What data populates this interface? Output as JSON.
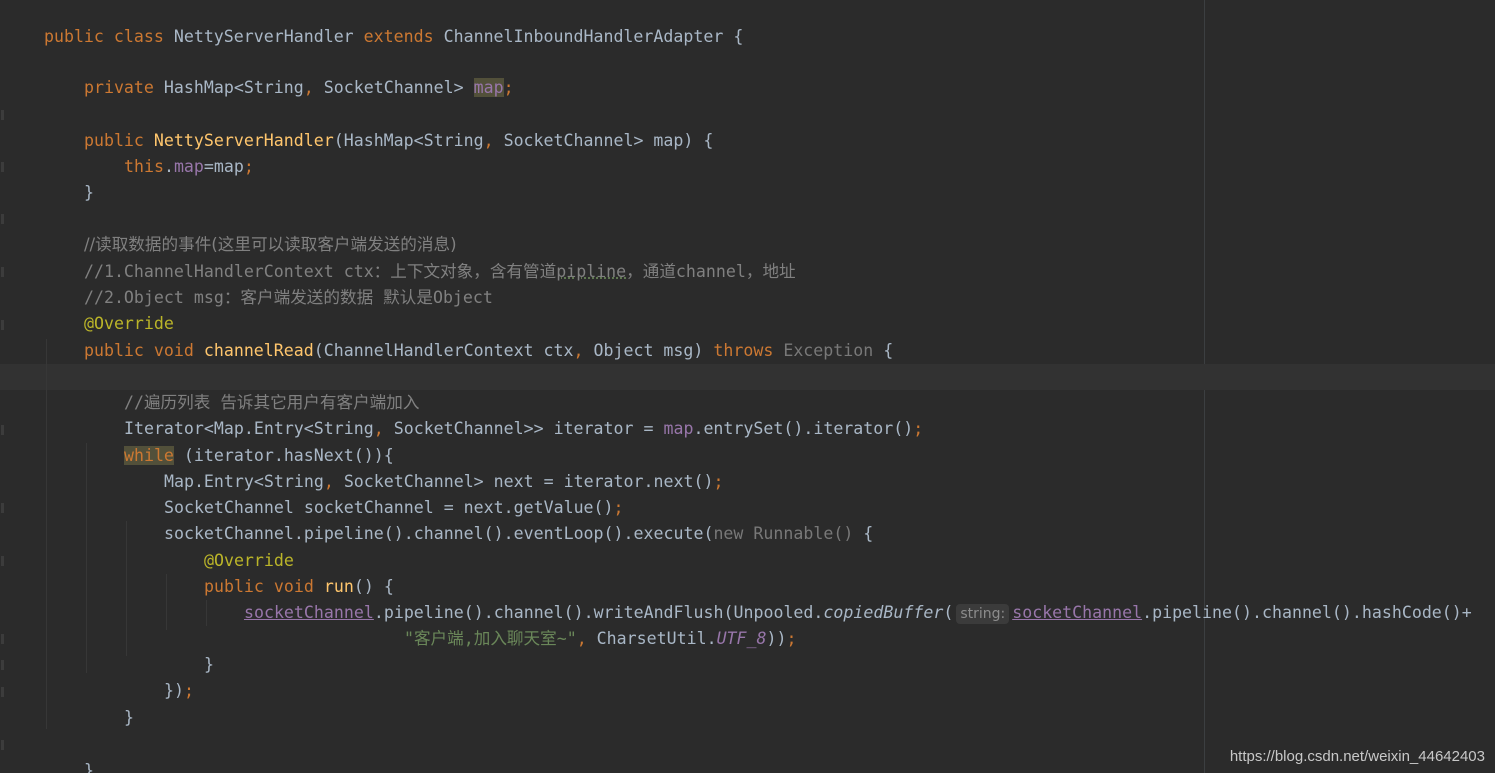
{
  "code": {
    "l1": {
      "t1": "public class ",
      "t2": "NettyServerHandler ",
      "t3": "extends ",
      "t4": "ChannelInboundHandlerAdapter {"
    },
    "l2": {
      "t1": "private ",
      "t2": "HashMap<String",
      "t3": ", ",
      "t4": "SocketChannel> ",
      "t5": "map",
      "t6": ";"
    },
    "l3": {
      "t1": "public ",
      "t2": "NettyServerHandler",
      "t3": "(HashMap<String",
      "t4": ", ",
      "t5": "SocketChannel> map) {"
    },
    "l4": {
      "t1": "this",
      "t2": ".",
      "t3": "map",
      "t4": "=map",
      "t5": ";"
    },
    "l5": {
      "t1": "}"
    },
    "l6": {
      "t1": "//读取数据的事件(这里可以读取客户端发送的消息)"
    },
    "l7": {
      "t1": "//1.ChannelHandlerContext ctx：上下文对象，含有管道",
      "t2": "pipline",
      "t3": "，通道channel，地址"
    },
    "l8": {
      "t1": "//2.Object msg：客户端发送的数据 默认是Object"
    },
    "l9": {
      "t1": "@Override"
    },
    "l10": {
      "t1": "public void ",
      "t2": "channelRead",
      "t3": "(ChannelHandlerContext ctx",
      "t4": ", ",
      "t5": "Object msg) ",
      "t6": "throws ",
      "t7": "Exception",
      "t8": " {"
    },
    "l11": {
      "t1": "//遍历列表 告诉其它用户有客户端加入"
    },
    "l12": {
      "t1": "Iterator<Map.Entry<String",
      "t2": ", ",
      "t3": "SocketChannel>> iterator = ",
      "t4": "map",
      "t5": ".entrySet().iterator()",
      "t6": ";"
    },
    "l13": {
      "t1": "while",
      "t2": " (iterator.hasNext()){"
    },
    "l14": {
      "t1": "Map.Entry<String",
      "t2": ", ",
      "t3": "SocketChannel> next = iterator.next()",
      "t4": ";"
    },
    "l15": {
      "t1": "SocketChannel socketChannel = next.getValue()",
      "t2": ";"
    },
    "l16": {
      "t1": "socketChannel.pipeline().channel().eventLoop().execute(",
      "t2": "new ",
      "t3": "Runnable()",
      "t4": " {"
    },
    "l17": {
      "t1": "@Override"
    },
    "l18": {
      "t1": "public void ",
      "t2": "run",
      "t3": "() {"
    },
    "l19": {
      "t1": "socketChannel",
      "t2": ".pipeline().channel().writeAndFlush(Unpooled.",
      "t3": "copiedBuffer",
      "t4": "(",
      "hint": "string:",
      "t5": "socketChannel",
      "t6": ".pipeline().channel().hashCode()+"
    },
    "l20": {
      "t1": "\"客户端,加入聊天室~\"",
      "t2": ", ",
      "t3": "CharsetUtil.",
      "t4": "UTF_8",
      "t5": "))",
      "t6": ";"
    },
    "l21": {
      "t1": "}"
    },
    "l22": {
      "t1": "})",
      "t2": ";"
    },
    "l23": {
      "t1": "}"
    },
    "l24": {
      "t1": "}"
    }
  },
  "watermark": "https://blog.csdn.net/weixin_44642403"
}
